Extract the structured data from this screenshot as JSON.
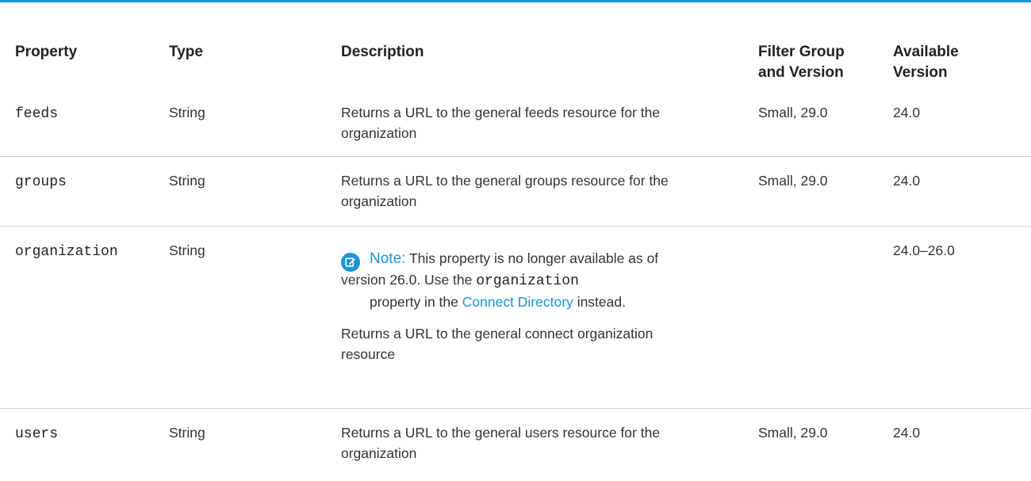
{
  "headers": {
    "property": "Property",
    "type": "Type",
    "description": "Description",
    "filter_line1": "Filter Group",
    "filter_line2": "and Version",
    "available_line1": "Available",
    "available_line2": "Version"
  },
  "rows": [
    {
      "property": "feeds",
      "type": "String",
      "desc_line1": "Returns a URL to the general feeds resource for the",
      "desc_line2": "organization",
      "filter": "Small, 29.0",
      "available": "24.0"
    },
    {
      "property": "groups",
      "type": "String",
      "desc_line1": "Returns a URL to the general groups resource for the",
      "desc_line2": "organization",
      "filter": "Small, 29.0",
      "available": "24.0"
    },
    {
      "property": "organization",
      "type": "String",
      "note": {
        "icon": "edit-note-icon",
        "title": "Note:",
        "line1": "This property is no longer available as of",
        "line2_pre": "version 26.0. Use the",
        "line2_code": "organization",
        "line3_pre": "property in the",
        "line3_link": "Connect Directory",
        "line3_post": "instead."
      },
      "desc_line1": "Returns a URL to the general connect organization",
      "desc_line2": "resource",
      "filter": "",
      "available": "24.0–26.0"
    },
    {
      "property": "users",
      "type": "String",
      "desc_line1": "Returns a URL to the general users resource for the",
      "desc_line2": "organization",
      "filter": "Small, 29.0",
      "available": "24.0"
    }
  ],
  "colors": {
    "accent": "#1b96d3",
    "rule": "#d4d4d4",
    "text": "#333333"
  }
}
